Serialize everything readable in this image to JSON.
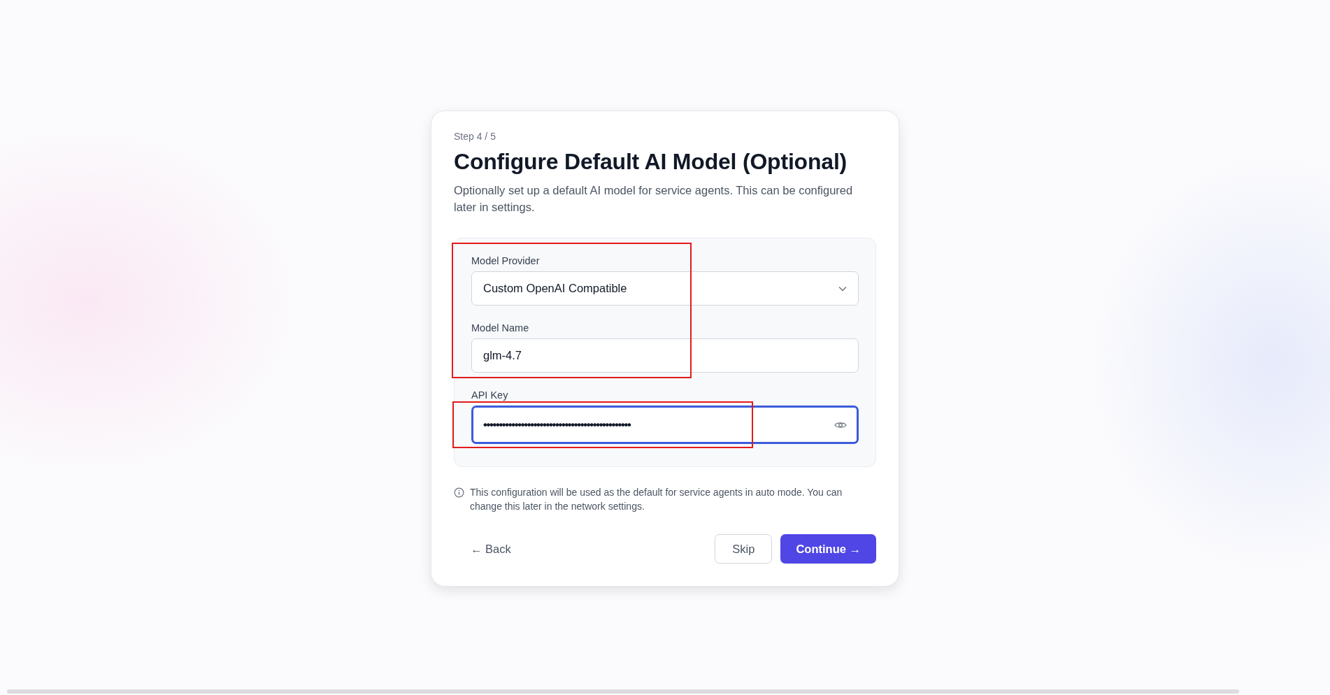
{
  "step": "Step 4 / 5",
  "title": "Configure Default AI Model (Optional)",
  "description": "Optionally set up a default AI model for service agents. This can be configured later in settings.",
  "form": {
    "groups": [
      {
        "highlighted": true,
        "fields": [
          {
            "kind": "select",
            "label": "Model Provider",
            "value": "Custom OpenAI Compatible",
            "focused": false
          },
          {
            "kind": "text",
            "label": "Model Name",
            "value": "glm-4.7",
            "focused": false
          }
        ]
      },
      {
        "highlighted": true,
        "fields": [
          {
            "kind": "password",
            "label": "API Key",
            "value": "•••••••••••••••••••••••••••••••••••••••••••••••",
            "focused": true
          }
        ]
      }
    ]
  },
  "note": "This configuration will be used as the default for service agents in auto mode. You can change this later in the network settings.",
  "buttons": [
    {
      "kind": "back",
      "label": "← Back"
    },
    {
      "kind": "secondary",
      "label": "Skip"
    },
    {
      "kind": "primary",
      "label": "Continue →"
    }
  ]
}
